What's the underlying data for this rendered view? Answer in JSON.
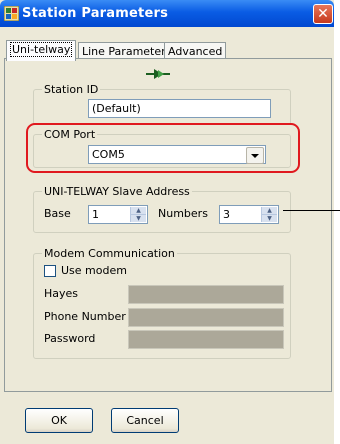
{
  "window": {
    "title": "Station Parameters",
    "close_glyph": "✕"
  },
  "tabs": [
    {
      "label": "Uni-telway",
      "active": true
    },
    {
      "label": "Line Parameters",
      "active": false
    },
    {
      "label": "Advanced",
      "active": false
    }
  ],
  "station_id": {
    "legend": "Station ID",
    "value": "(Default)"
  },
  "com_port": {
    "legend": "COM Port",
    "selected": "COM5",
    "highlight_color": "#e0191f"
  },
  "slave_address": {
    "legend": "UNI-TELWAY Slave Address",
    "base_label": "Base",
    "base_value": "1",
    "numbers_label": "Numbers",
    "numbers_value": "3"
  },
  "modem": {
    "legend": "Modem Communication",
    "use_modem_label": "Use modem",
    "use_modem_checked": false,
    "hayes_label": "Hayes",
    "phone_label": "Phone Number",
    "password_label": "Password"
  },
  "buttons": {
    "ok": "OK",
    "cancel": "Cancel"
  }
}
